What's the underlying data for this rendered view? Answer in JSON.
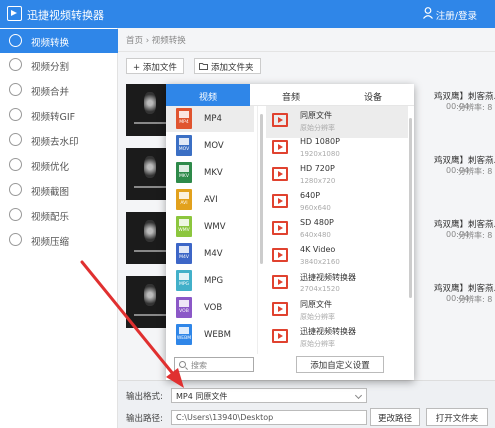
{
  "app": {
    "title": "迅捷视频转换器",
    "login": "注册/登录"
  },
  "sidebar": {
    "items": [
      {
        "label": "视频转换",
        "icon": "convert-icon"
      },
      {
        "label": "视频分割",
        "icon": "split-icon"
      },
      {
        "label": "视频合并",
        "icon": "merge-icon"
      },
      {
        "label": "视频转GIF",
        "icon": "gif-icon"
      },
      {
        "label": "视频去水印",
        "icon": "watermark-icon"
      },
      {
        "label": "视频优化",
        "icon": "optimize-icon"
      },
      {
        "label": "视频截图",
        "icon": "screenshot-icon"
      },
      {
        "label": "视频配乐",
        "icon": "music-icon"
      },
      {
        "label": "视频压缩",
        "icon": "compress-icon"
      }
    ]
  },
  "breadcrumb": "首页 › 视频转换",
  "toolbar": {
    "add_file": "+ 添加文件",
    "add_folder": "添加文件夹"
  },
  "files": [
    {
      "name": "鸡双鹰】刺客燕...! .m",
      "duration": "00:04",
      "resolution": "分辨率: 8"
    },
    {
      "name": "鸡双鹰】刺客燕...! .m",
      "duration": "00:04",
      "resolution": "分辨率: 8"
    },
    {
      "name": "鸡双鹰】刺客燕...! .m",
      "duration": "00:04",
      "resolution": "分辨率: 8"
    },
    {
      "name": "鸡双鹰】刺客燕...! .m",
      "duration": "00:04",
      "resolution": "分辨率: 8"
    }
  ],
  "popup": {
    "tabs": [
      "视频",
      "音频",
      "设备"
    ],
    "formats": [
      {
        "label": "MP4",
        "color": "#e0542f"
      },
      {
        "label": "MOV",
        "color": "#3b6fc4"
      },
      {
        "label": "MKV",
        "color": "#2e8a4a"
      },
      {
        "label": "AVI",
        "color": "#e2a11d"
      },
      {
        "label": "WMV",
        "color": "#8cc63e"
      },
      {
        "label": "M4V",
        "color": "#3d66c7"
      },
      {
        "label": "MPG",
        "color": "#42b0c9"
      },
      {
        "label": "VOB",
        "color": "#8b58c7"
      },
      {
        "label": "WEBM",
        "color": "#2f86e8"
      }
    ],
    "qualities": [
      {
        "name": "同原文件",
        "sub": "原始分辨率"
      },
      {
        "name": "HD 1080P",
        "sub": "1920x1080"
      },
      {
        "name": "HD 720P",
        "sub": "1280x720"
      },
      {
        "name": "640P",
        "sub": "960x640"
      },
      {
        "name": "SD 480P",
        "sub": "640x480"
      },
      {
        "name": "4K Video",
        "sub": "3840x2160"
      },
      {
        "name": "迅捷视频转换器",
        "sub": "2704x1520"
      },
      {
        "name": "同原文件",
        "sub": "原始分辨率"
      },
      {
        "name": "迅捷视频转换器",
        "sub": "原始分辨率"
      }
    ],
    "search_placeholder": "搜索",
    "custom_button": "添加自定义设置"
  },
  "bottom": {
    "format_label": "输出格式:",
    "format_value": "MP4  同原文件",
    "path_label": "输出路径:",
    "path_value": "C:\\Users\\13940\\Desktop",
    "change_path": "更改路径",
    "open_folder": "打开文件夹"
  },
  "colors": {
    "accent": "#2f86e8",
    "arrow": "#e03030"
  }
}
